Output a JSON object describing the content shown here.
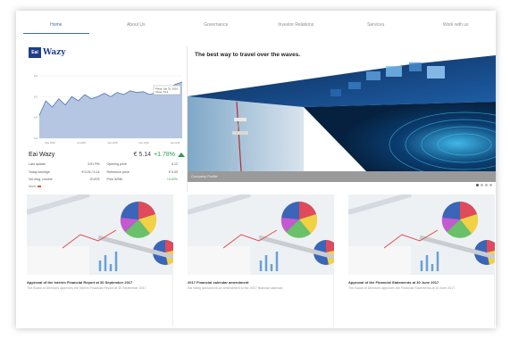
{
  "nav": {
    "items": [
      "Home",
      "About Us",
      "Governance",
      "Investor Relations",
      "Services",
      "Work with us"
    ],
    "active_index": 0
  },
  "stock": {
    "logo_mark": "Eai",
    "logo_text": "Wazy",
    "chart_tooltip": [
      "Press, Jan 31, 2019",
      "Close: 5.14"
    ],
    "y_ticks": [
      "5.5",
      "5.0",
      "4.5",
      "4.0"
    ],
    "x_ticks": [
      "May 2018",
      "Jul 2018",
      "Sep 2018",
      "Nov 2018",
      "Jan 2019"
    ],
    "name": "Eai Wazy",
    "price": "€ 5.14",
    "change": "+1.78%",
    "stats": [
      [
        "Last update",
        "3:51 PM",
        "Opening price",
        "5.12"
      ],
      [
        "Today low/high",
        "€ 5.05 / 5.14",
        "Reference price",
        "€ 5.05"
      ],
      [
        "Vol./Avg. volume",
        "20,876",
        "Prior 52Wk",
        "+0.00%"
      ]
    ],
    "more_link": "More"
  },
  "hero": {
    "title": "The best way to travel over the waves.",
    "caption": "Company Profile",
    "slides": 4,
    "active_slide": 0
  },
  "cards": [
    {
      "title": "Approval of the Interim Financial Report at 30 September 2017",
      "desc": "The Board of Directors approves the Interim Financial Report at 30 September 2017."
    },
    {
      "title": "2017 Financial calendar amendment",
      "desc": "Eai Wazy announces an amendment to the 2017 financial calendar."
    },
    {
      "title": "Approval of the Financial Statements at 30 June 2017",
      "desc": "The Board of Directors approves the Financial Statements at 30 June 2017."
    }
  ],
  "chart_data": {
    "type": "area",
    "x": [
      "May 2018",
      "Jul 2018",
      "Sep 2018",
      "Nov 2018",
      "Jan 2019"
    ],
    "values": [
      4.55,
      4.9,
      4.75,
      4.95,
      4.8,
      5.0,
      4.9,
      5.05,
      4.95,
      5.0,
      5.08,
      5.0,
      5.1,
      5.05,
      5.14,
      5.1,
      5.12,
      5.05,
      5.1,
      5.14,
      5.2,
      5.3,
      5.35
    ],
    "ylim": [
      4.0,
      5.5
    ],
    "color": "#4a73b9",
    "fill": "#a8bcdd"
  },
  "colors": {
    "accent": "#3d6bb3",
    "positive": "#2e9b4f",
    "logo": "#1f3d8a"
  }
}
